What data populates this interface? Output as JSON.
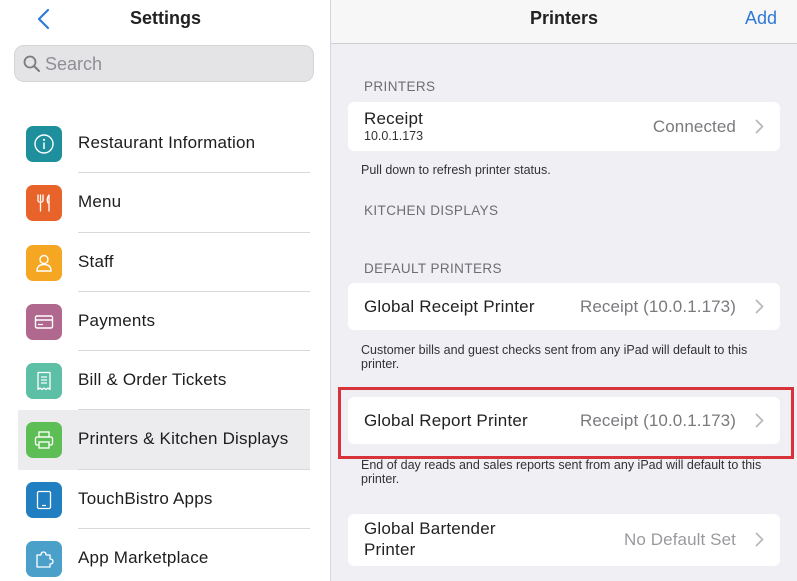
{
  "left_pane": {
    "title": "Settings",
    "search": {
      "placeholder": "Search",
      "value": ""
    },
    "menu": [
      {
        "label": "Restaurant Information",
        "icon": "info-icon",
        "color": "#1e8f9c",
        "selected": false
      },
      {
        "label": "Menu",
        "icon": "fork-knife-icon",
        "color": "#e8632a",
        "selected": false
      },
      {
        "label": "Staff",
        "icon": "person-icon",
        "color": "#f5a623",
        "selected": false
      },
      {
        "label": "Payments",
        "icon": "card-icon",
        "color": "#b0688f",
        "selected": false
      },
      {
        "label": "Bill & Order Tickets",
        "icon": "receipt-icon",
        "color": "#5cbfa6",
        "selected": false
      },
      {
        "label": "Printers & Kitchen Displays",
        "icon": "printer-icon",
        "color": "#5cbe54",
        "selected": true
      },
      {
        "label": "TouchBistro Apps",
        "icon": "tablet-icon",
        "color": "#1f7fc0",
        "selected": false
      },
      {
        "label": "App Marketplace",
        "icon": "puzzle-icon",
        "color": "#4aa0c9",
        "selected": false
      }
    ]
  },
  "right_pane": {
    "title": "Printers",
    "add_label": "Add",
    "printers_section": {
      "header": "PRINTERS",
      "receipt_title": "Receipt",
      "receipt_ip": "10.0.1.173",
      "receipt_status": "Connected",
      "note": "Pull down to refresh printer status."
    },
    "kitchen_section": {
      "header": "KITCHEN DISPLAYS"
    },
    "default_section": {
      "header": "DEFAULT PRINTERS",
      "global_receipt": {
        "title": "Global Receipt Printer",
        "value": "Receipt (10.0.1.173)",
        "note": "Customer bills and guest checks sent from any iPad will default to this printer."
      },
      "global_report": {
        "title": "Global Report Printer",
        "value": "Receipt (10.0.1.173)",
        "note": "End of day reads and sales reports sent from any iPad will default to this printer."
      },
      "global_bartender": {
        "title_line1": "Global Bartender",
        "title_line2": "Printer",
        "value": "No Default Set"
      }
    }
  },
  "colors": {
    "accent": "#2f7ad6",
    "highlight": "#d8323a",
    "selected_row": "#ececee"
  }
}
